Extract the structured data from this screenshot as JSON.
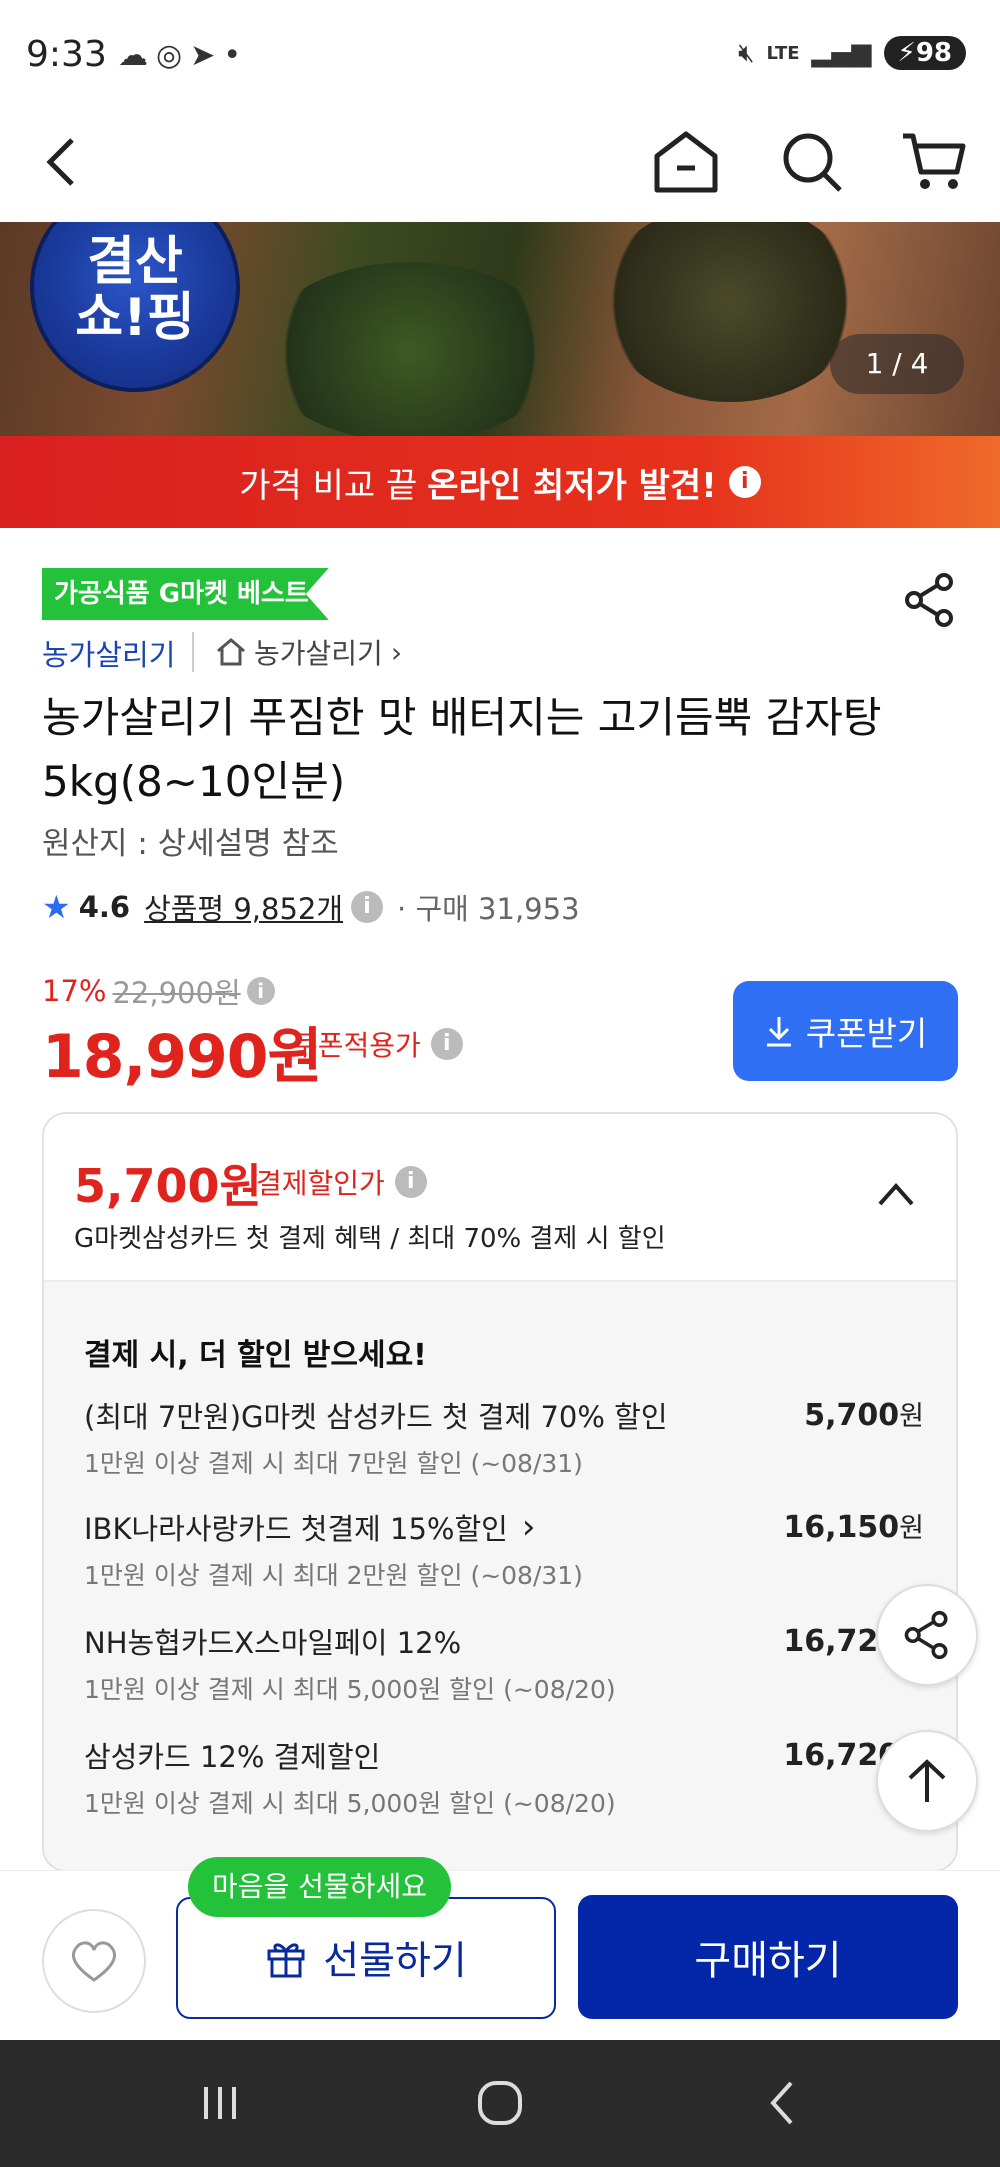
{
  "status_bar": {
    "time": "9:33",
    "network": "LTE",
    "battery": "98"
  },
  "hero": {
    "logo_text": "결산\n쇼!핑",
    "pager": "1 / 4"
  },
  "banner": {
    "text_prefix": "가격 비교 끝",
    "text_bold": "온라인 최저가 발견!"
  },
  "product": {
    "badge": "가공식품 G마켓 베스트",
    "seller": "농가살리기",
    "store_link": "농가살리기",
    "title": "농가살리기 푸짐한 맛 배터지는 고기듬뿍 감자탕 5kg(8~10인분)",
    "origin": "원산지 : 상세설명 참조",
    "rating": "4.6",
    "reviews": "상품평 9,852개",
    "purchases": "구매 31,953"
  },
  "pricing": {
    "discount_pct": "17%",
    "original_price": "22,900원",
    "price": "18,990원",
    "price_label": "쿠폰적용가",
    "coupon_button": "쿠폰받기"
  },
  "payment": {
    "amount": "5,700원",
    "amount_label": "결제할인가",
    "subtitle": "G마켓삼성카드 첫 결제 혜택 / 최대 70% 결제 시 할인",
    "section_title": "결제 시, 더 할인 받으세요!",
    "rows": [
      {
        "title": "(최대 7만원)G마켓 삼성카드 첫 결제 70% 할인",
        "sub": "1만원 이상 결제 시 최대 7만원 할인 (~08/31)",
        "amount": "5,700",
        "unit": "원"
      },
      {
        "title": "IBK나라사랑카드 첫결제 15%할인",
        "sub": "1만원 이상 결제 시 최대 2만원 할인 (~08/31)",
        "amount": "16,150",
        "unit": "원"
      },
      {
        "title": "NH농협카드X스마일페이 12%",
        "sub": "1만원 이상 결제 시 최대 5,000원 할인 (~08/20)",
        "amount": "16,720",
        "unit": "원"
      },
      {
        "title": "삼성카드 12% 결제할인",
        "sub": "1만원 이상 결제 시 최대 5,000원 할인 (~08/20)",
        "amount": "16,720",
        "unit": "원"
      }
    ]
  },
  "bottom": {
    "gift_bubble": "마음을 선물하세요",
    "gift_button": "선물하기",
    "buy_button": "구매하기"
  },
  "colors": {
    "accent_red": "#e0241d",
    "brand_blue": "#0426a8",
    "coupon_blue": "#2e6ff3",
    "badge_green": "#24c13a"
  }
}
